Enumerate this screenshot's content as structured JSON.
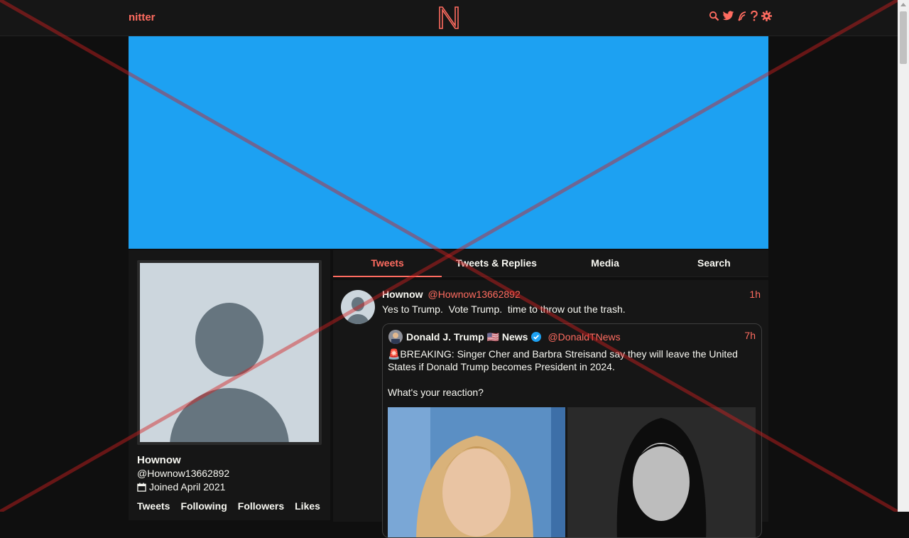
{
  "nav": {
    "brand": "nitter",
    "logo_letter": "N",
    "icons": [
      "search-icon",
      "twitter-bird-icon",
      "rss-icon",
      "help-icon",
      "settings-gear-icon"
    ]
  },
  "colors": {
    "accent": "#ff6c60",
    "banner": "#1da1f2",
    "background": "#0f0f0f",
    "panel": "#161616"
  },
  "profile": {
    "fullname": "Hownow",
    "handle": "@Hownow13662892",
    "joined": "Joined April 2021",
    "stats": [
      "Tweets",
      "Following",
      "Followers",
      "Likes"
    ]
  },
  "tabs": [
    {
      "label": "Tweets",
      "active": true
    },
    {
      "label": "Tweets & Replies",
      "active": false
    },
    {
      "label": "Media",
      "active": false
    },
    {
      "label": "Search",
      "active": false
    }
  ],
  "tweet": {
    "fullname": "Hownow",
    "username": "@Hownow13662892",
    "date": "1h",
    "text": "Yes to Trump.  Vote Trump.  time to throw out the trash.",
    "quote": {
      "fullname": "Donald J. Trump 🇺🇸 News",
      "verified": true,
      "username": "@DonaldTNews",
      "date": "7h",
      "text_line1": "🚨BREAKING: Singer Cher and Barbra Streisand say they will leave the United States if Donald Trump becomes President in 2024.",
      "text_line2": "What's your reaction?"
    }
  }
}
